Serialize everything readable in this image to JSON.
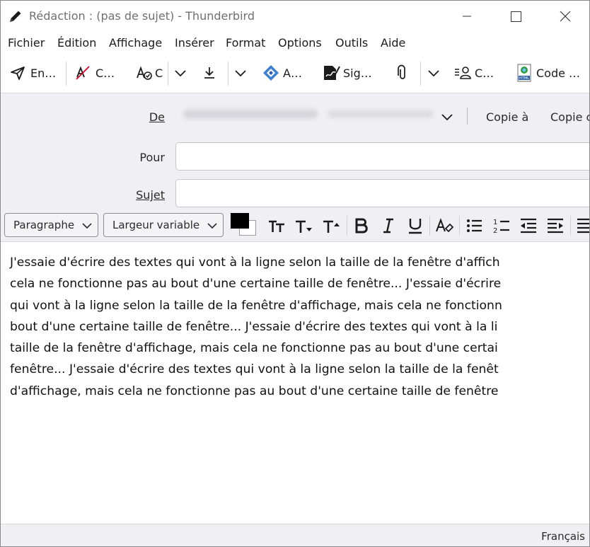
{
  "window": {
    "title": "Rédaction : (pas de sujet) - Thunderbird"
  },
  "menu": [
    "Fichier",
    "Édition",
    "Affichage",
    "Insérer",
    "Format",
    "Options",
    "Outils",
    "Aide"
  ],
  "toolbar": {
    "send": "En…",
    "spell": "C…",
    "security": "C",
    "attach_vcard": "A…",
    "signature": "Sig…",
    "contacts": "C…",
    "code": "Code …"
  },
  "header": {
    "from_label": "De",
    "to_label": "Pour",
    "subject_label": "Sujet",
    "cc_link": "Copie à",
    "bcc_link": "Copie c",
    "to_value": "",
    "subject_value": ""
  },
  "format": {
    "paragraph_select": "Paragraphe",
    "font_select": "Largeur variable",
    "text_color": "#000000",
    "bg_color": "#ffffff"
  },
  "body": {
    "lines": [
      "J'essaie d'écrire des textes qui vont à la ligne selon la taille de la fenêtre d'affich",
      "cela ne fonctionne pas au bout d'une certaine taille de fenêtre... J'essaie d'écrire",
      "qui vont à la ligne selon la taille de la fenêtre d'affichage, mais cela ne fonctionn",
      "bout d'une certaine taille de fenêtre... J'essaie d'écrire des textes qui vont à la li",
      "taille de la fenêtre d'affichage, mais cela ne fonctionne pas au bout d'une certai",
      "fenêtre... J'essaie d'écrire des textes qui vont à la ligne selon la taille de la fenêt",
      "d'affichage, mais cela ne fonctionne pas au bout d'une certaine taille de fenêtre"
    ]
  },
  "status": {
    "language": "Français"
  }
}
